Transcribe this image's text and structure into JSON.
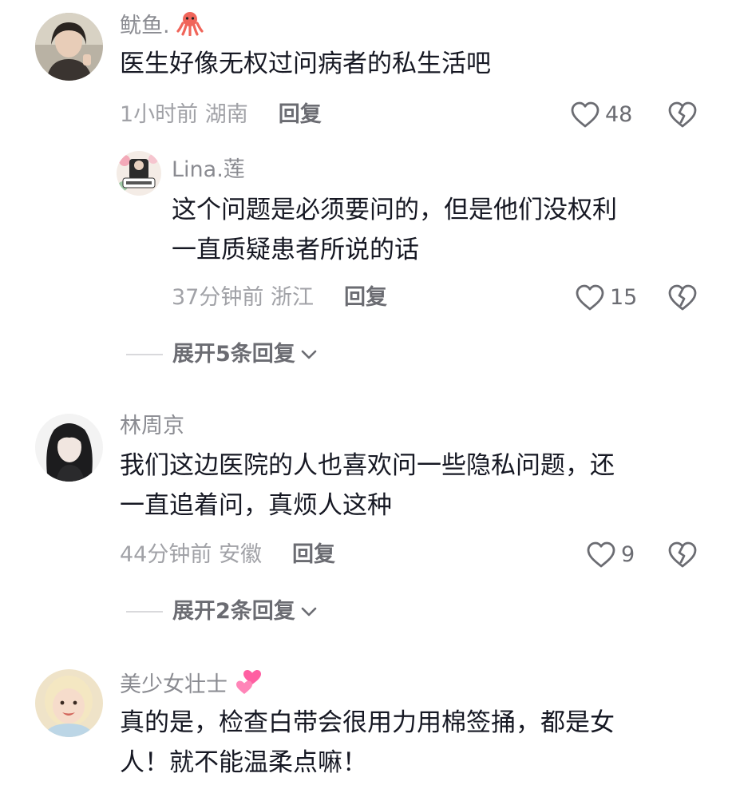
{
  "comments": [
    {
      "username": "鱿鱼.",
      "text": "医生好像无权过问病者的私生活吧",
      "time_location": "1小时前 湖南",
      "reply_label": "回复",
      "likes": "48",
      "replies": [
        {
          "username": "Lina.莲",
          "text_line1": "这个问题是必须要问的，但是他们没权利",
          "text_line2": "一直质疑患者所说的话",
          "time_location": "37分钟前 浙江",
          "reply_label": "回复",
          "likes": "15"
        }
      ],
      "expand_label": "展开5条回复"
    },
    {
      "username": "林周京",
      "text_line1": "我们这边医院的人也喜欢问一些隐私问题，还",
      "text_line2": "一直追着问，真烦人这种",
      "time_location": "44分钟前 安徽",
      "reply_label": "回复",
      "likes": "9",
      "expand_label": "展开2条回复"
    },
    {
      "username": "美少女壮士",
      "text_line1": "真的是，检查白带会很用力用棉签捅，都是女",
      "text_line2": "人！就不能温柔点嘛！"
    }
  ],
  "colors": {
    "text_primary": "#161823",
    "text_secondary": "#8a8b91",
    "meta": "#a1a2a7",
    "icon_stroke": "#6b6c72"
  },
  "icons": [
    "heart-outline-icon",
    "broken-heart-icon",
    "chevron-down-icon",
    "octopus-emoji",
    "two-hearts-emoji"
  ]
}
